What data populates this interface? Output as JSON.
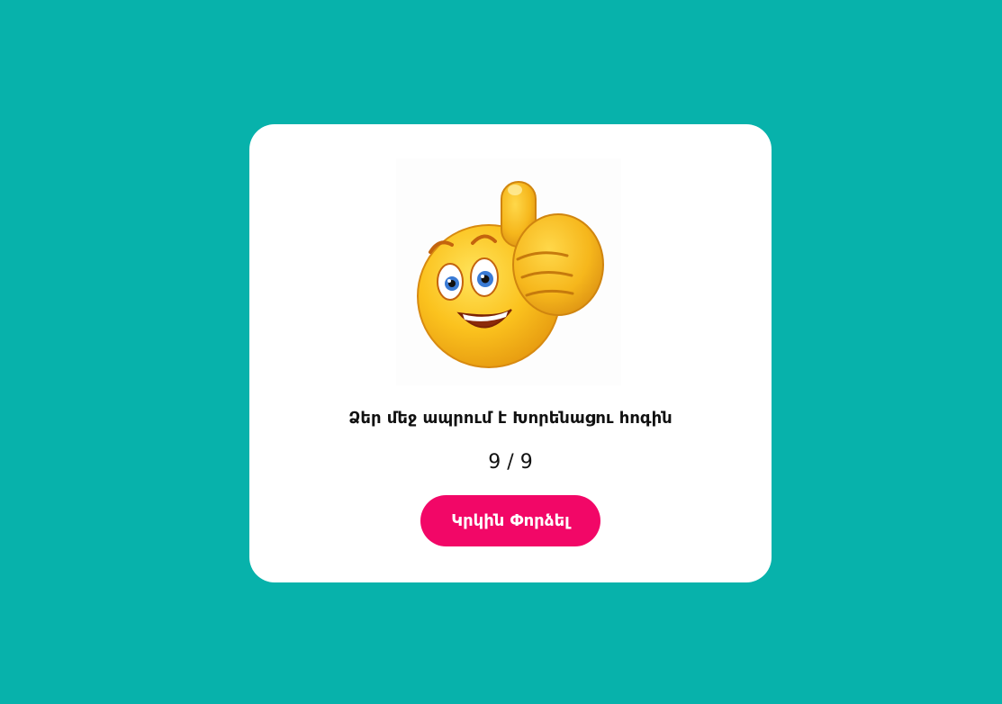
{
  "result": {
    "image_icon": "thumbs-up-smiley-icon",
    "message": "Ձեր մեջ ապրում է Խորենացու հոգին",
    "score": "9 / 9"
  },
  "actions": {
    "retry_label": "Կրկին Փորձել"
  },
  "colors": {
    "background": "#07b2ab",
    "card": "#ffffff",
    "button": "#f20767",
    "button_text": "#ffffff",
    "text": "#111111"
  }
}
